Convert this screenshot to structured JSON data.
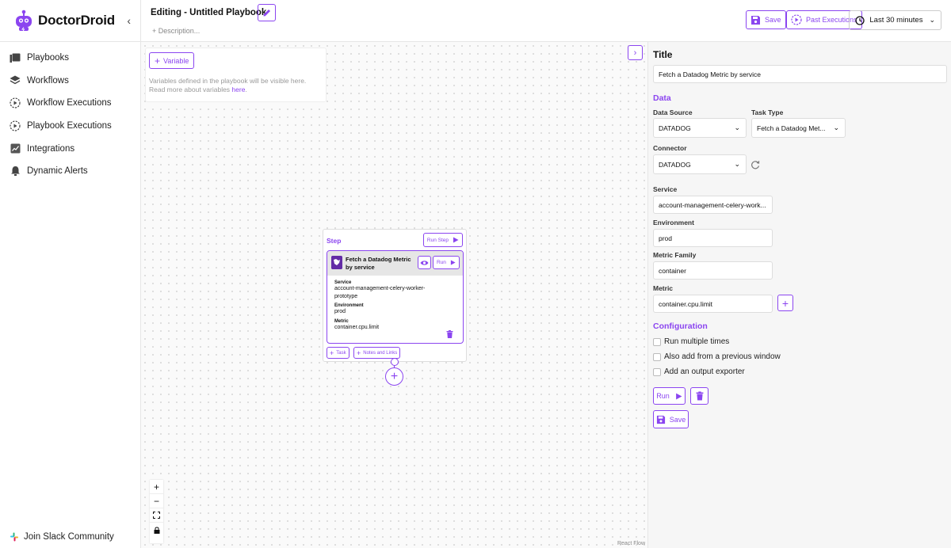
{
  "colors": {
    "accent": "#8b45f0",
    "accent_light": "#ece0fd",
    "canvas_bg": "#fafafa",
    "panel_bg": "#f6f6f6"
  },
  "sidebar": {
    "brand": "DoctorDroid",
    "items": [
      {
        "label": "Playbooks",
        "icon": "book-icon"
      },
      {
        "label": "Workflows",
        "icon": "layers-icon"
      },
      {
        "label": "Workflow Executions",
        "icon": "play-circle-icon"
      },
      {
        "label": "Playbook Executions",
        "icon": "play-circle-icon"
      },
      {
        "label": "Integrations",
        "icon": "chart-icon"
      },
      {
        "label": "Dynamic Alerts",
        "icon": "bell-icon"
      }
    ],
    "footer": "Join Slack Community"
  },
  "header": {
    "title": "Editing - Untitled Playbook",
    "description_placeholder": "+ Description...",
    "save_label": "Save",
    "past_executions_label": "Past Executions",
    "time_range": "Last 30 minutes"
  },
  "canvas": {
    "variable_button": "Variable",
    "variable_help": "Variables defined in the playbook will be visible here. Read more about variables ",
    "variable_link": "here",
    "variable_help_end": ".",
    "step": {
      "label": "Step",
      "run_step": "Run Step",
      "task_title": "Fetch a Datadog Metric by service",
      "task_run": "Run",
      "fields": [
        {
          "label": "Service",
          "value": "account-management-celery-worker-prototype"
        },
        {
          "label": "Environment",
          "value": "prod"
        },
        {
          "label": "Metric",
          "value": "container.cpu.limit"
        }
      ],
      "add_task": "Task",
      "add_notes": "Notes and Links"
    },
    "zoom_in": "+",
    "zoom_out": "−",
    "react_flow": "React Flow"
  },
  "panel": {
    "title_label": "Title",
    "title_value": "Fetch a Datadog Metric by service",
    "data_section": "Data",
    "data_source_label": "Data Source",
    "data_source_value": "DATADOG",
    "task_type_label": "Task Type",
    "task_type_value": "Fetch a Datadog Met...",
    "connector_label": "Connector",
    "connector_value": "DATADOG",
    "service_label": "Service",
    "service_value": "account-management-celery-work...",
    "environment_label": "Environment",
    "environment_value": "prod",
    "metric_family_label": "Metric Family",
    "metric_family_value": "container",
    "metric_label": "Metric",
    "metric_value": "container.cpu.limit",
    "config_section": "Configuration",
    "options": [
      "Run multiple times",
      "Also add from a previous window",
      "Add an output exporter"
    ],
    "run_label": "Run",
    "save_label": "Save"
  }
}
